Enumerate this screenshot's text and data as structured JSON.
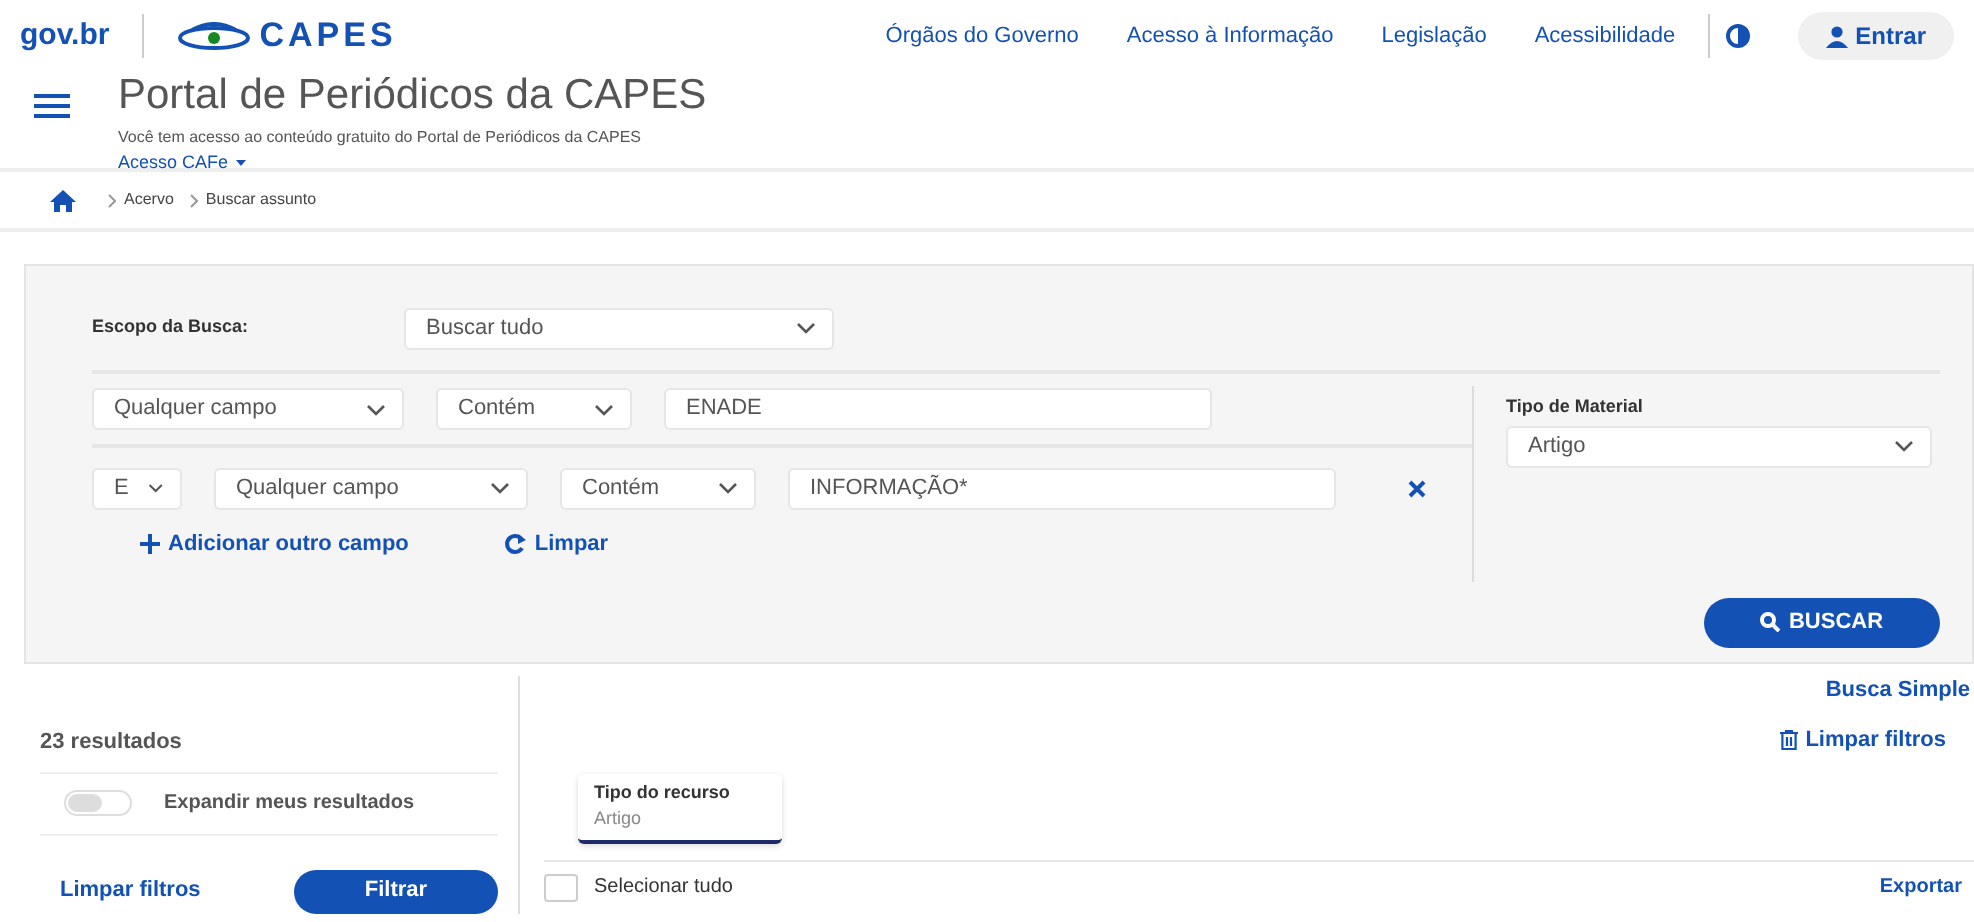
{
  "header": {
    "brand": "gov.br",
    "logo_text": "CAPES",
    "links": [
      "Órgãos do Governo",
      "Acesso à Informação",
      "Legislação",
      "Acessibilidade"
    ],
    "sign_in": "Entrar"
  },
  "portal": {
    "title": "Portal de Periódicos da CAPES",
    "subtitle": "Você tem acesso ao conteúdo gratuito do Portal de Periódicos da CAPES",
    "access_menu": "Acesso CAFe"
  },
  "breadcrumb": [
    "Acervo",
    "Buscar assunto"
  ],
  "search": {
    "scope_label": "Escopo da Busca:",
    "scope": "Buscar tudo",
    "rows": [
      {
        "field": "Qualquer campo",
        "condition": "Contém",
        "value": "ENADE",
        "removable": false
      },
      {
        "operator": "E",
        "field": "Qualquer campo",
        "condition": "Contém",
        "value": "INFORMAÇÃO*",
        "removable": true
      }
    ],
    "add_field": "Adicionar outro campo",
    "clear": "Limpar",
    "material_label": "Tipo de Material",
    "material": "Artigo",
    "submit": "BUSCAR"
  },
  "simple_search": "Busca Simple",
  "results": {
    "count": "23 resultados",
    "expand": {
      "label": "Expandir meus resultados",
      "on": false
    },
    "clear_filters": "Limpar filtros",
    "filter": "Filtrar",
    "clear_all": "Limpar filtros",
    "chips": [
      {
        "title": "Tipo do recurso",
        "value": "Artigo"
      }
    ],
    "select_all": {
      "label": "Selecionar tudo",
      "checked": false
    },
    "export": "Exportar"
  }
}
